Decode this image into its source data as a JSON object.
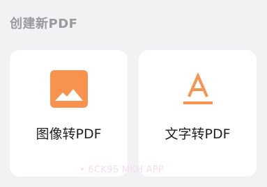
{
  "section": {
    "title": "创建新PDF"
  },
  "cards": [
    {
      "label": "图像转PDF",
      "icon": "image-icon"
    },
    {
      "label": "文字转PDF",
      "icon": "text-a-icon"
    }
  ],
  "watermark": "• 6CK9S MKH APP",
  "colors": {
    "background": "#f2f2f4",
    "card": "#ffffff",
    "accent": "#f7924f",
    "title": "#9a9a9e",
    "label": "#1f1f1f"
  }
}
